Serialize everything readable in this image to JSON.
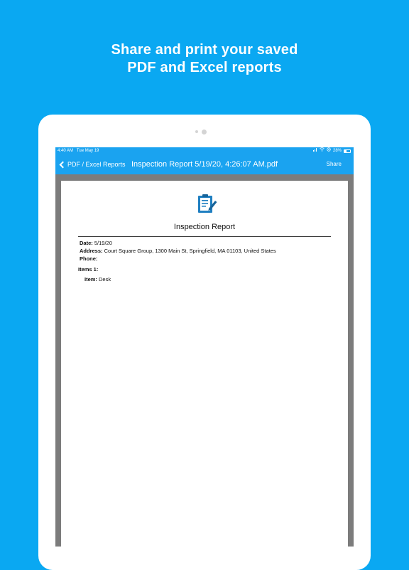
{
  "headline": {
    "line1": "Share and print your saved",
    "line2": "PDF and Excel reports"
  },
  "status_bar": {
    "time": "4:40 AM",
    "date": "Tue May 19",
    "battery": "28%"
  },
  "nav": {
    "back_label": "PDF / Excel Reports",
    "title": "Inspection Report 5/19/20, 4:26:07 AM.pdf",
    "share_label": "Share"
  },
  "report": {
    "title": "Inspection Report",
    "date_label": "Date:",
    "date_value": "5/19/20",
    "address_label": "Address:",
    "address_value": "Court Square Group, 1300 Main St, Springfield, MA  01103, United States",
    "phone_label": "Phone:",
    "phone_value": "",
    "items_heading": "Items 1:",
    "item_label": "Item:",
    "item_value": "Desk"
  },
  "colors": {
    "background": "#0aa8f2",
    "nav_bar": "#1aa3f0",
    "pdf_viewer_gray": "#7c7c7c",
    "icon_blue": "#1f7fc1"
  },
  "icons": {
    "back": "chevron-left-icon",
    "report": "clipboard-edit-icon"
  }
}
